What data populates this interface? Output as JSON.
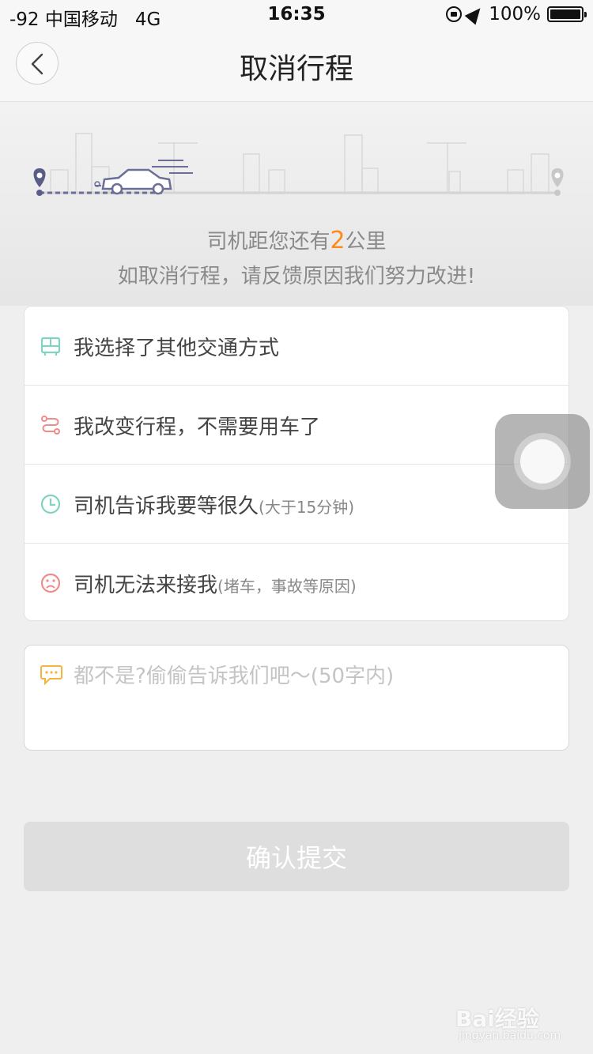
{
  "status_bar": {
    "signal": "-92",
    "carrier": "中国移动",
    "network": "4G",
    "time": "16:35",
    "battery": "100%",
    "battery_level": 1.0
  },
  "nav": {
    "title": "取消行程",
    "back_icon": "chevron-left-icon"
  },
  "hero": {
    "distance_prefix": "司机距您还有",
    "distance_value": "2",
    "distance_suffix": "公里",
    "message": "如取消行程，请反馈原因我们努力改进!"
  },
  "reasons": [
    {
      "icon": "bus-icon",
      "label": "我选择了其他交通方式",
      "note": ""
    },
    {
      "icon": "route-icon",
      "label": "我改变行程，不需要用车了",
      "note": ""
    },
    {
      "icon": "clock-icon",
      "label": "司机告诉我要等很久",
      "note": "(大于15分钟)"
    },
    {
      "icon": "sad-face-icon",
      "label": "司机无法来接我",
      "note": "(堵车，事故等原因)"
    }
  ],
  "comment": {
    "placeholder": "都不是?偷偷告诉我们吧～(50字内)",
    "value": ""
  },
  "submit_label": "确认提交",
  "colors": {
    "accent": "#ff8a1c",
    "bus_icon": "#7fd3c0",
    "route_icon": "#f08b8b",
    "clock_icon": "#7fd3c0",
    "sad_icon": "#f08b8b",
    "comment_icon": "#f5b43a",
    "submit_bg": "#dedede"
  },
  "watermark": {
    "brand": "Bai经验",
    "url": "jingyan.baidu.com"
  }
}
